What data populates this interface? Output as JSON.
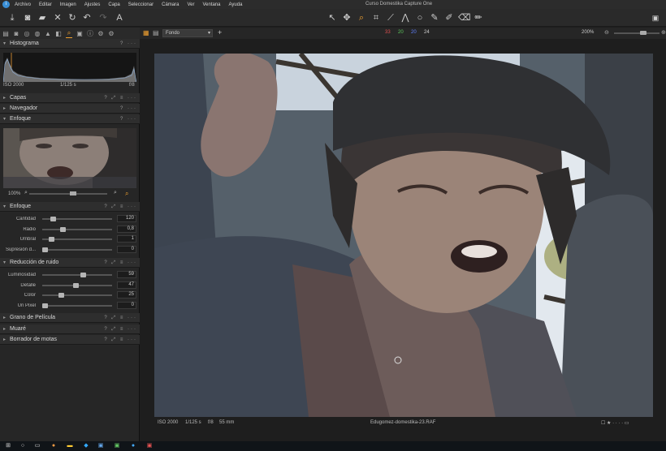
{
  "app": {
    "window_title": "Curso Domestika Capture One",
    "menu": [
      "Archivo",
      "Editar",
      "Imagen",
      "Ajustes",
      "Capa",
      "Seleccionar",
      "Cámara",
      "Ver",
      "Ventana",
      "Ayuda"
    ]
  },
  "toolbar": {
    "icons": [
      "import-icon",
      "camera-icon",
      "folder-icon",
      "close-icon",
      "rotate-icon",
      "undo-icon",
      "redo-icon",
      "text-tool-icon"
    ],
    "cursor_tools": [
      "select-icon",
      "pan-icon",
      "hand-icon",
      "zoom-icon",
      "crop-icon",
      "keystone-icon",
      "straighten-icon",
      "circle-icon",
      "picker-icon",
      "brush-icon",
      "eraser-icon",
      "annotate-icon"
    ],
    "active_tool": "zoom-icon"
  },
  "viewer_bar": {
    "variant": "Fondo",
    "color_counts": [
      {
        "value": "33",
        "color": "#e05050"
      },
      {
        "value": "20",
        "color": "#5ec85e"
      },
      {
        "value": "20",
        "color": "#6080ff"
      },
      {
        "value": "24",
        "color": "#d0d0d0"
      }
    ],
    "zoom": "200%"
  },
  "sidebar": {
    "histogram": {
      "title": "Histograma",
      "iso": "ISO 2000",
      "shutter": "1/125 s",
      "aperture": "f/8"
    },
    "collapsed_1": [
      {
        "title": "Capas"
      },
      {
        "title": "Navegador"
      }
    ],
    "focus_tool": {
      "title": "Enfoque",
      "zoom": "100%"
    },
    "sharpening": {
      "title": "Enfoque",
      "rows": [
        {
          "label": "Cantidad",
          "value": "120",
          "level": 0.12
        },
        {
          "label": "Radio",
          "value": "0,8",
          "level": 0.27
        },
        {
          "label": "Umbral",
          "value": "1",
          "level": 0.1
        },
        {
          "label": "Supresión d...",
          "value": "0",
          "level": 0.0
        }
      ]
    },
    "noise_reduction": {
      "title": "Reducción de ruido",
      "rows": [
        {
          "label": "Luminosidad",
          "value": "59",
          "level": 0.59
        },
        {
          "label": "Detalle",
          "value": "47",
          "level": 0.47
        },
        {
          "label": "Color",
          "value": "25",
          "level": 0.25
        },
        {
          "label": "Un Pixel",
          "value": "0",
          "level": 0.0
        }
      ]
    },
    "collapsed_2": [
      {
        "title": "Grano de Película"
      },
      {
        "title": "Muaré"
      },
      {
        "title": "Borrador de motas"
      }
    ]
  },
  "viewer": {
    "iso": "ISO 2000",
    "shutter": "1/125 s",
    "aperture": "f/8",
    "focal": "55 mm",
    "filename": "Edugomez-domestika-23.RAF"
  }
}
